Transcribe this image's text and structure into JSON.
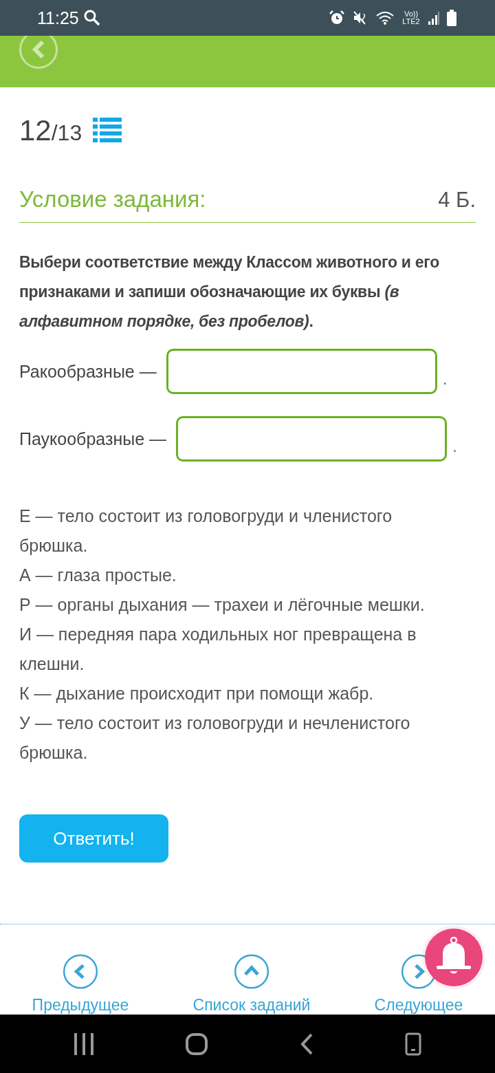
{
  "status_bar": {
    "time": "11:25",
    "network": "Vo)) LTE2"
  },
  "counter": {
    "current": "12",
    "total": "/13"
  },
  "section": {
    "title": "Условие задания:",
    "points": "4 Б."
  },
  "instruction": "Выбери соответствие между Классом животного и его признаками и запиши обозначающие их буквы *(в алфавитном порядке, без пробелов)*.",
  "fields": [
    {
      "label": "Ракообразные —",
      "suffix": "."
    },
    {
      "label": "Паукообразные —",
      "suffix": "."
    }
  ],
  "options": [
    "Е — тело состоит из головогруди и членистого брюшка.",
    "А — глаза простые.",
    "Р — органы дыхания — трахеи и лёгочные мешки.",
    "И — передняя пара ходильных ног превращена в клешни.",
    "К — дыхание происходит при помощи жабр.",
    "У — тело состоит из головогруди и нечленистого брюшка."
  ],
  "submit": "Ответить!",
  "nav": [
    {
      "kind": "prev",
      "label": "Предыдущее"
    },
    {
      "kind": "list",
      "label": "Список заданий"
    },
    {
      "kind": "next",
      "label": "Следующее"
    }
  ]
}
